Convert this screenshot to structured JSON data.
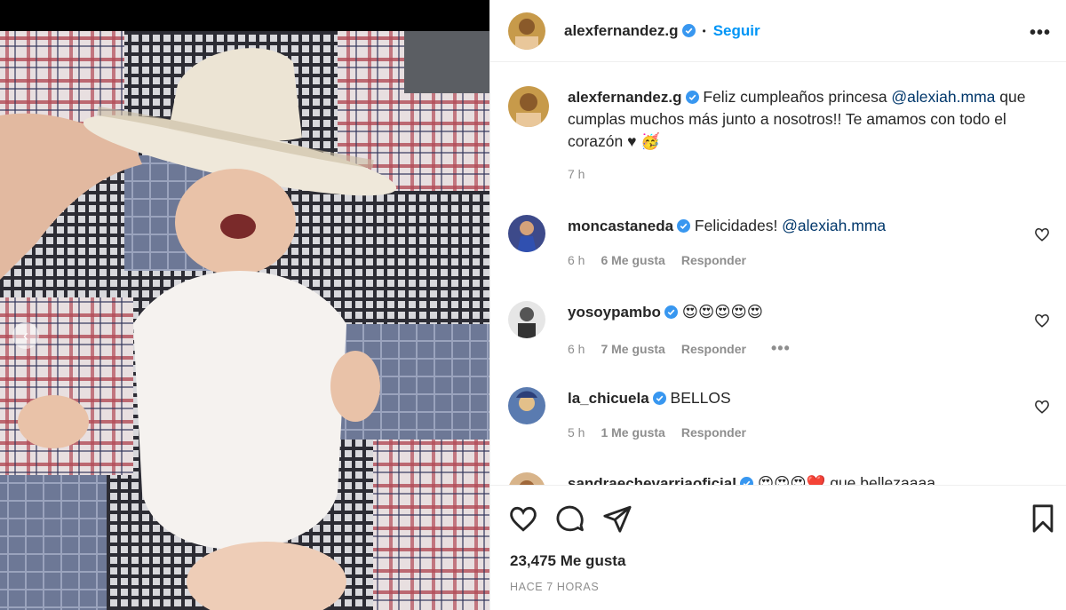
{
  "post": {
    "author": "alexfernandez.g",
    "follow_label": "Seguir",
    "dot": "•",
    "more_label": "•••",
    "caption_text_1": "Feliz cumpleaños princesa ",
    "caption_mention": "@alexiah.mma",
    "caption_text_2": " que cumplas muchos más junto a nosotros!! Te amamos con todo el corazón ♥ 🥳",
    "caption_time": "7 h"
  },
  "comments": [
    {
      "user": "moncastaneda",
      "text": "Felicidades! ",
      "mention": "@alexiah.mma",
      "time": "6 h",
      "likes": "6 Me gusta",
      "reply": "Responder"
    },
    {
      "user": "yosoypambo",
      "text": "😍😍😍😍😍",
      "time": "6 h",
      "likes": "7 Me gusta",
      "reply": "Responder",
      "more": "•••"
    },
    {
      "user": "la_chicuela",
      "text": "BELLOS",
      "time": "5 h",
      "likes": "1 Me gusta",
      "reply": "Responder"
    },
    {
      "user": "sandraechevarriaoficial",
      "text": "😍😍😍❤️ que bellezaaaa"
    }
  ],
  "footer": {
    "likes": "23,475 Me gusta",
    "time_ago": "HACE 7 HORAS"
  },
  "icons": {
    "verified": "verified-badge-icon",
    "heart": "heart-icon",
    "comment": "comment-icon",
    "share": "share-icon",
    "save": "bookmark-icon",
    "prev": "chevron-left-icon"
  },
  "colors": {
    "accent": "#0095f6",
    "mention": "#00376b",
    "secondary_text": "#8e8e8e",
    "verified": "#3897f0"
  }
}
